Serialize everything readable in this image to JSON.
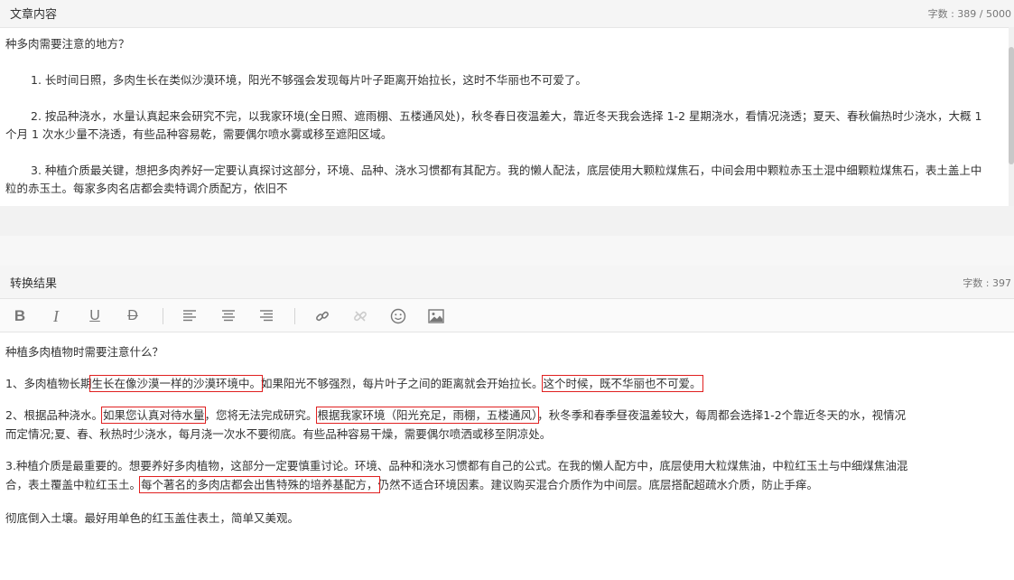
{
  "header1": {
    "title": "文章内容",
    "count": "字数 : 389 / 5000"
  },
  "source": {
    "line0": "种多肉需要注意的地方？",
    "p1": "1. 长时间日照，多肉生长在类似沙漠环境，阳光不够强会发现每片叶子距离开始拉长，这时不华丽也不可爱了。",
    "p2": "2. 按品种浇水，水量认真起来会研究不完，以我家环境(全日照、遮雨棚、五楼通风处)，秋冬春日夜温差大，靠近冬天我会选择 1-2 星期浇水，看情况浇透；夏天、春秋偏热时少浇水，大概 1 个月 1 次水少量不浇透，有些品种容易乾，需要偶尔喷水雾或移至遮阳区域。",
    "p3": "3. 种植介质最关键，想把多肉养好一定要认真探讨这部分，环境、品种、浇水习惯都有其配方。我的懒人配法，底层使用大颗粒煤焦石，中间会用中颗粒赤玉土混中细颗粒煤焦石，表土盖上中粒的赤玉土。每家多肉名店都会卖特调介质配方，依旧不"
  },
  "header2": {
    "title": "转换结果",
    "count": "字数 : 397"
  },
  "toolbar": {
    "bold": "B",
    "italic": "I",
    "underline": "U",
    "strike": "D",
    "align_left": "align-left-icon",
    "align_center": "align-center-icon",
    "align_right": "align-right-icon",
    "link": "link-icon",
    "unlink": "unlink-icon",
    "emoji": "smiley-icon",
    "image": "image-icon"
  },
  "result": {
    "line0": "种植多肉植物时需要注意什么？",
    "l1a": "1、多肉植物长期",
    "l1b": "生长在像沙漠一样的沙漠环境中。",
    "l1c": "如果阳光不够强烈，每片叶子之间的距离就会开始拉长。",
    "l1d": "这个时候，既不华丽也不可爱。",
    "l2a": "2、根据品种浇水。",
    "l2b": "如果您认真对待水量",
    "l2c": "，您将无法完成研究。",
    "l2d": "根据我家环境（阳光充足，雨棚，五楼通风）",
    "l2e": "，秋冬季和春季昼夜温差较大，每周都会选择1-2个靠近冬天的水，视情况",
    "l2f": "而定情况;夏、春、秋热时少浇水，每月浇一次水不要彻底。有些品种容易干燥，需要偶尔喷洒或移至阴凉处。",
    "l3a": "3.种植介质是最重要的。想要养好多肉植物，这部分一定要慎重讨论。环境、品种和浇水习惯都有自己的公式。在我的懒人配方中，底层使用大粒煤焦油，中粒红玉土与中细煤焦油混",
    "l3b": "合，表土覆盖中粒红玉土。",
    "l3c": "每个著名的多肉店都会出售特殊的培养基配方，",
    "l3d": "仍然不适合环境因素。建议购买混合介质作为中间层。底层搭配超疏水介质，防止手痒。",
    "l4": "彻底倒入土壤。最好用单色的红玉盖住表土，简单又美观。"
  }
}
